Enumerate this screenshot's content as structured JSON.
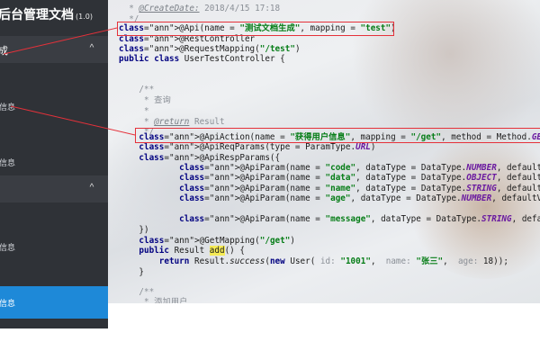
{
  "sidebar": {
    "brand_title": "后台管理文档",
    "brand_version": "(1.0)",
    "groups": [
      {
        "label": "成",
        "chevron": "^"
      },
      {
        "label": "",
        "chevron": "^"
      }
    ],
    "items": [
      {
        "label": "信息"
      },
      {
        "label": "信息"
      },
      {
        "label": "信息"
      },
      {
        "label": "信息"
      }
    ]
  },
  "code": {
    "lines": [
      {
        "t": "  * @CreateDate: 2018/4/15 17:18"
      },
      {
        "t": "  */"
      },
      {
        "t": "@Api(name = \"测试文档生成\", mapping = \"test\")"
      },
      {
        "t": "@RestController"
      },
      {
        "t": "@RequestMapping(\"/test\")"
      },
      {
        "t": "public class UserTestController {"
      },
      {
        "t": ""
      },
      {
        "t": "    /**"
      },
      {
        "t": "     * 查询"
      },
      {
        "t": "     *"
      },
      {
        "t": "     * @return Result"
      },
      {
        "t": "     */"
      },
      {
        "t": "    @ApiAction(name = \"获得用户信息\", mapping = \"/get\", method = Method.GET)"
      },
      {
        "t": "    @ApiReqParams(type = ParamType.URL)"
      },
      {
        "t": "    @ApiRespParams({"
      },
      {
        "t": "            @ApiParam(name = \"code\", dataType = DataType.NUMBER, defaultValue ="
      },
      {
        "t": "            @ApiParam(name = \"data\", dataType = DataType.OBJECT, defaultValue ="
      },
      {
        "t": "            @ApiParam(name = \"name\", dataType = DataType.STRING, defaultValue ="
      },
      {
        "t": "            @ApiParam(name = \"age\", dataType = DataType.NUMBER, defaultValue ="
      },
      {
        "t": ""
      },
      {
        "t": "            @ApiParam(name = \"message\", dataType = DataType.STRING, defaultValue"
      },
      {
        "t": "    })"
      },
      {
        "t": "    @GetMapping(\"/get\")"
      },
      {
        "t": "    public Result add() {"
      },
      {
        "t": "        return Result.success(new User( id: \"1001\",  name: \"张三\",  age: 18));"
      },
      {
        "t": "    }"
      },
      {
        "t": ""
      },
      {
        "t": "    /**"
      },
      {
        "t": "     * 添加用户"
      }
    ]
  },
  "colors": {
    "sidebar_bg": "#2f3237",
    "active_item": "#1e89d8",
    "annotation_red": "#e5313a",
    "highlight": "#f5eb55"
  }
}
